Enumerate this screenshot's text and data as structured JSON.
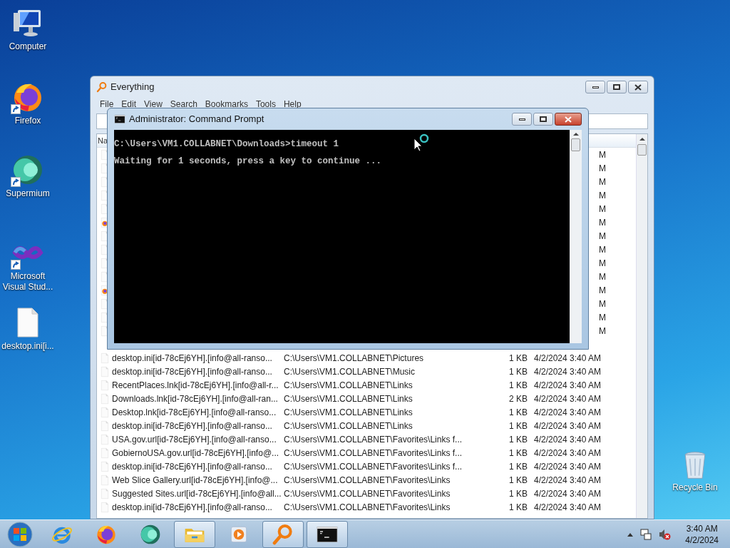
{
  "desktop_icons": [
    {
      "kind": "computer",
      "label": "Computer"
    },
    {
      "kind": "firefox",
      "label": "Firefox"
    },
    {
      "kind": "supermium",
      "label": "Supermium"
    },
    {
      "kind": "visualstudio",
      "label": "Microsoft Visual Stud..."
    },
    {
      "kind": "file",
      "label": "desktop.ini[i..."
    }
  ],
  "recycle_bin": {
    "label": "Recycle Bin"
  },
  "everything_window": {
    "title": "Everything",
    "menu": [
      "File",
      "Edit",
      "View",
      "Search",
      "Bookmarks",
      "Tools",
      "Help"
    ],
    "header": "Na",
    "hidden_rows": [
      {
        "kind": "file",
        "date": "M"
      },
      {
        "kind": "file",
        "date": "M"
      },
      {
        "kind": "file",
        "date": "M"
      },
      {
        "kind": "file",
        "date": "M"
      },
      {
        "kind": "file",
        "date": "M"
      },
      {
        "kind": "html",
        "date": "M"
      },
      {
        "kind": "file",
        "date": "M"
      },
      {
        "kind": "file",
        "date": "M"
      },
      {
        "kind": "file",
        "date": "M"
      },
      {
        "kind": "file",
        "date": "M"
      },
      {
        "kind": "html",
        "date": "M"
      },
      {
        "kind": "file",
        "date": "M"
      },
      {
        "kind": "file",
        "date": "M"
      },
      {
        "kind": "file",
        "date": "M"
      }
    ],
    "rows": [
      {
        "name": "desktop.ini[id-78cEj6YH].[info@all-ranso...",
        "path": "C:\\Users\\VM1.COLLABNET\\Pictures",
        "size": "1 KB",
        "modified": "4/2/2024 3:40 AM"
      },
      {
        "name": "desktop.ini[id-78cEj6YH].[info@all-ranso...",
        "path": "C:\\Users\\VM1.COLLABNET\\Music",
        "size": "1 KB",
        "modified": "4/2/2024 3:40 AM"
      },
      {
        "name": "RecentPlaces.lnk[id-78cEj6YH].[info@all-r...",
        "path": "C:\\Users\\VM1.COLLABNET\\Links",
        "size": "1 KB",
        "modified": "4/2/2024 3:40 AM"
      },
      {
        "name": "Downloads.lnk[id-78cEj6YH].[info@all-ran...",
        "path": "C:\\Users\\VM1.COLLABNET\\Links",
        "size": "2 KB",
        "modified": "4/2/2024 3:40 AM"
      },
      {
        "name": "Desktop.lnk[id-78cEj6YH].[info@all-ranso...",
        "path": "C:\\Users\\VM1.COLLABNET\\Links",
        "size": "1 KB",
        "modified": "4/2/2024 3:40 AM"
      },
      {
        "name": "desktop.ini[id-78cEj6YH].[info@all-ranso...",
        "path": "C:\\Users\\VM1.COLLABNET\\Links",
        "size": "1 KB",
        "modified": "4/2/2024 3:40 AM"
      },
      {
        "name": "USA.gov.url[id-78cEj6YH].[info@all-ranso...",
        "path": "C:\\Users\\VM1.COLLABNET\\Favorites\\Links f...",
        "size": "1 KB",
        "modified": "4/2/2024 3:40 AM"
      },
      {
        "name": "GobiernoUSA.gov.url[id-78cEj6YH].[info@...",
        "path": "C:\\Users\\VM1.COLLABNET\\Favorites\\Links f...",
        "size": "1 KB",
        "modified": "4/2/2024 3:40 AM"
      },
      {
        "name": "desktop.ini[id-78cEj6YH].[info@all-ranso...",
        "path": "C:\\Users\\VM1.COLLABNET\\Favorites\\Links f...",
        "size": "1 KB",
        "modified": "4/2/2024 3:40 AM"
      },
      {
        "name": "Web Slice Gallery.url[id-78cEj6YH].[info@...",
        "path": "C:\\Users\\VM1.COLLABNET\\Favorites\\Links",
        "size": "1 KB",
        "modified": "4/2/2024 3:40 AM"
      },
      {
        "name": "Suggested Sites.url[id-78cEj6YH].[info@all...",
        "path": "C:\\Users\\VM1.COLLABNET\\Favorites\\Links",
        "size": "1 KB",
        "modified": "4/2/2024 3:40 AM"
      },
      {
        "name": "desktop.ini[id-78cEj6YH].[info@all-ranso...",
        "path": "C:\\Users\\VM1.COLLABNET\\Favorites\\Links",
        "size": "1 KB",
        "modified": "4/2/2024 3:40 AM"
      }
    ]
  },
  "cmd_window": {
    "title": "Administrator:  Command Prompt",
    "lines": [
      "C:\\Users\\VM1.COLLABNET\\Downloads>timeout 1",
      "Waiting for 1 seconds, press a key to continue ..."
    ]
  },
  "taskbar": {
    "items": [
      {
        "kind": "ie",
        "running": false
      },
      {
        "kind": "firefox",
        "running": false
      },
      {
        "kind": "supermium",
        "running": false
      },
      {
        "kind": "explorer",
        "running": true
      },
      {
        "kind": "mediaplayer",
        "running": false
      },
      {
        "kind": "everything",
        "running": true
      },
      {
        "kind": "cmd",
        "running": true
      }
    ],
    "clock": {
      "time": "3:40 AM",
      "date": "4/2/2024"
    }
  }
}
